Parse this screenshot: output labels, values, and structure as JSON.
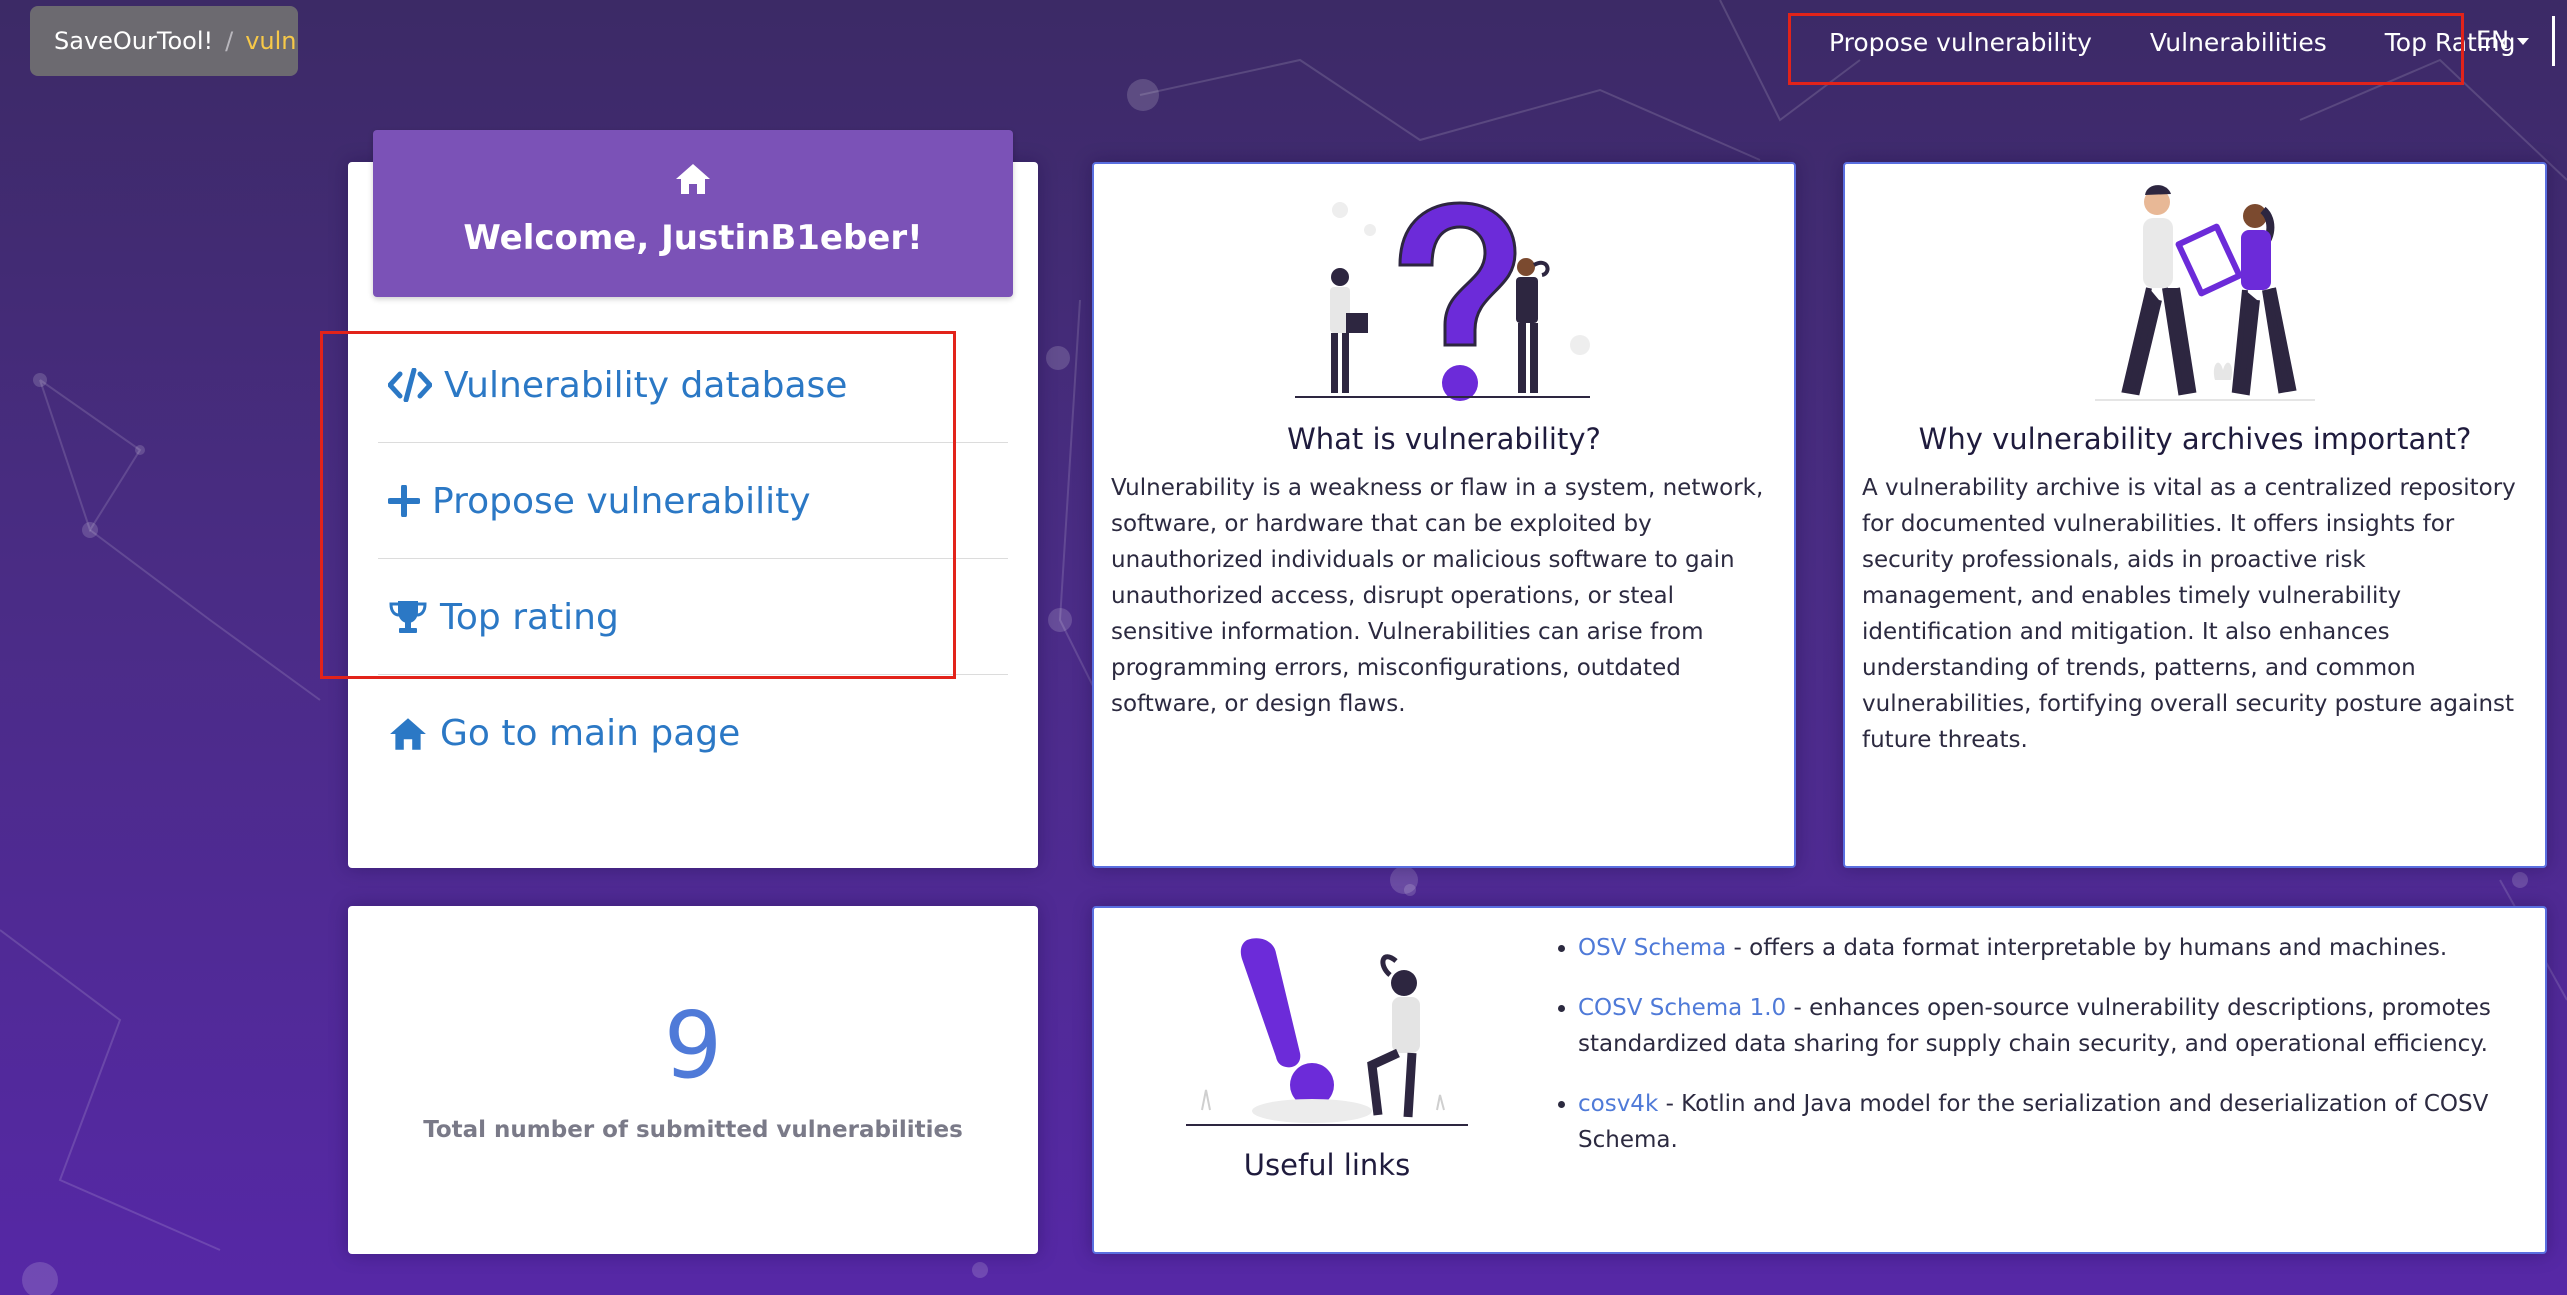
{
  "brand": {
    "name": "SaveOurTool!",
    "separator": "/",
    "section": "vuln"
  },
  "nav": {
    "items": [
      {
        "label": "Propose vulnerability"
      },
      {
        "label": "Vulnerabilities"
      },
      {
        "label": "Top Rating"
      }
    ],
    "language": "EN"
  },
  "welcome": {
    "title": "Welcome, JustinB1eber!",
    "menu": [
      {
        "label": "Vulnerability database",
        "icon": "code-icon"
      },
      {
        "label": "Propose vulnerability",
        "icon": "plus-icon"
      },
      {
        "label": "Top rating",
        "icon": "trophy-icon"
      },
      {
        "label": "Go to main page",
        "icon": "home-icon"
      }
    ]
  },
  "what_is": {
    "title": "What is vulnerability?",
    "text": "Vulnerability is a weakness or flaw in a system, network, software, or hardware that can be exploited by unauthorized individuals or malicious software to gain unauthorized access, disrupt operations, or steal sensitive information. Vulnerabilities can arise from programming errors, misconfigurations, outdated software, or design flaws."
  },
  "why_archive": {
    "title": "Why vulnerability archives important?",
    "text": "A vulnerability archive is vital as a centralized repository for documented vulnerabilities. It offers insights for security professionals, aids in proactive risk management, and enables timely vulnerability identification and mitigation. It also enhances understanding of trends, patterns, and common vulnerabilities, fortifying overall security posture against future threats."
  },
  "counter": {
    "value": "9",
    "label": "Total number of submitted vulnerabilities"
  },
  "useful_links": {
    "title": "Useful links",
    "items": [
      {
        "link": "OSV Schema",
        "desc": " - offers a data format interpretable by humans and machines."
      },
      {
        "link": "COSV Schema 1.0",
        "desc": " - enhances open-source vulnerability descriptions, promotes standardized data sharing for supply chain security, and operational efficiency."
      },
      {
        "link": "cosv4k",
        "desc": " - Kotlin and Java model for the serialization and deserialization of COSV Schema."
      }
    ]
  },
  "colors": {
    "accent": "#7b52b7",
    "link": "#2b78c5",
    "highlight": "#e2231a",
    "card_border": "#5a6fe0"
  }
}
